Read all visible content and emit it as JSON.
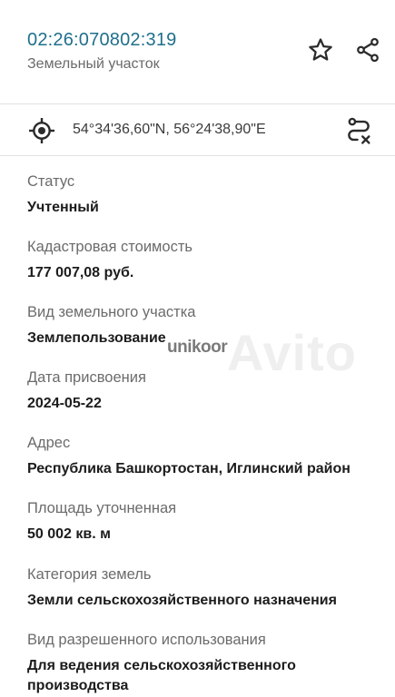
{
  "header": {
    "cadastral_number": "02:26:070802:319",
    "object_type": "Земельный участок",
    "favorite_icon": "star-outline-icon",
    "share_icon": "share-icon"
  },
  "location": {
    "coordinates": "54°34'36,60\"N, 56°24'38,90\"E",
    "locate_icon": "crosshair-target-icon",
    "route_icon": "route-clear-icon"
  },
  "fields": [
    {
      "label": "Статус",
      "value": "Учтенный"
    },
    {
      "label": "Кадастровая стоимость",
      "value": "177 007,08 руб."
    },
    {
      "label": "Вид земельного участка",
      "value": "Землепользование"
    },
    {
      "label": "Дата присвоения",
      "value": "2024-05-22"
    },
    {
      "label": "Адрес",
      "value": "Республика Башкортостан, Иглинский район"
    },
    {
      "label": "Площадь уточненная",
      "value": "50 002 кв. м"
    },
    {
      "label": "Категория земель",
      "value": "Земли сельскохозяйственного назначения"
    },
    {
      "label": "Вид разрешенного использования",
      "value": "Для ведения сельскохозяйственного производства"
    }
  ],
  "watermark": {
    "brand": "unikoor",
    "ghost_text": "Avito"
  },
  "colors": {
    "accent": "#1f6f8b",
    "label": "#6b6b6b",
    "value": "#1c1c1c",
    "divider": "#e2e2e2"
  }
}
